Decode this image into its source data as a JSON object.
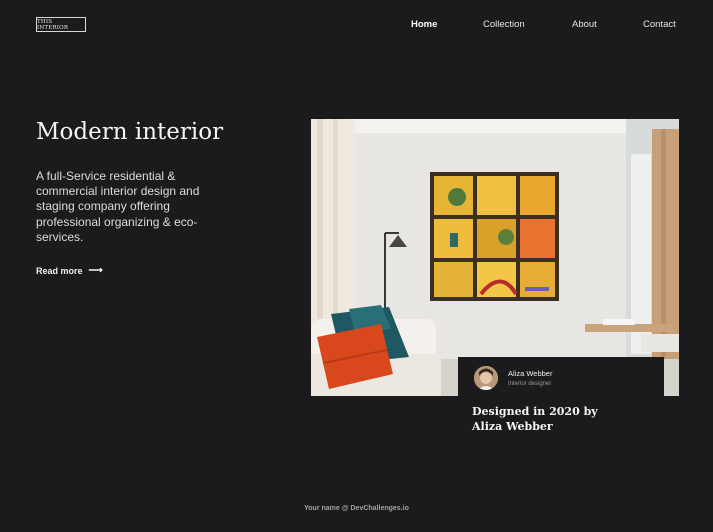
{
  "header": {
    "logo_text": "THIS INTERIOR",
    "nav": [
      {
        "label": "Home",
        "active": true
      },
      {
        "label": "Collection",
        "active": false
      },
      {
        "label": "About",
        "active": false
      },
      {
        "label": "Contact",
        "active": false
      }
    ]
  },
  "hero": {
    "title": "Modern interior",
    "description": "A full-Service residential & commercial interior design and staging company offering professional organizing & eco-services.",
    "read_more": "Read more",
    "read_more_icon": "arrow-right-icon"
  },
  "designer_card": {
    "name": "Aliza Webber",
    "role": "Interior designer",
    "designed_line_1": "Designed in 2020 by",
    "designed_line_2": "Aliza Webber"
  },
  "footer": {
    "credit": "Your name @ DevChallenges.io"
  },
  "colors": {
    "background": "#1b1b1d",
    "text": "#f2f2f2",
    "accent_mustard": "#e9b530",
    "pillow_orange": "#d9481c",
    "pillow_teal": "#1e5963"
  }
}
